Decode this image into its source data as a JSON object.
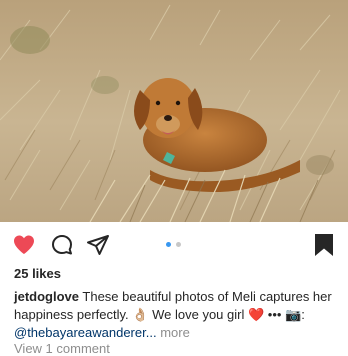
{
  "post": {
    "image_alt_subject": "golden dog lying in dry grass",
    "likes": "25 likes",
    "carousel": {
      "current": 1,
      "total": 2
    },
    "caption": {
      "username": "jetdoglove",
      "text_line1": "These beautiful photos of Meli captures her happiness perfectly.",
      "emoji_ok": "👌🏼",
      "text_line2": "We love you girl",
      "emoji_heart": "❤️",
      "ellipsis": "•••",
      "camera_emoji": "📷",
      "colon": ":",
      "mention": "@thebayareawanderer...",
      "more": "more"
    },
    "view_comments": "View 1 comment"
  },
  "colors": {
    "like_red": "#ed4956",
    "dot_active": "#3897f0",
    "dot_inactive": "#c7c7c7",
    "text": "#262626",
    "muted": "#8e8e8e"
  },
  "icons": {
    "like": "heart-icon",
    "comment": "comment-icon",
    "share": "paper-plane-icon",
    "save": "bookmark-icon"
  }
}
